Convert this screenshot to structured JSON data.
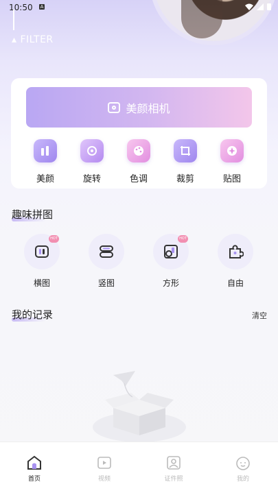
{
  "status_bar": {
    "time": "10:50",
    "notif": "A"
  },
  "header": {
    "filter_label": "FILTER"
  },
  "camera": {
    "label": "美颜相机"
  },
  "tools": [
    {
      "label": "美颜",
      "icon": "beauty-icon"
    },
    {
      "label": "旋转",
      "icon": "rotate-icon"
    },
    {
      "label": "色调",
      "icon": "palette-icon"
    },
    {
      "label": "裁剪",
      "icon": "crop-icon"
    },
    {
      "label": "贴图",
      "icon": "sticker-icon"
    }
  ],
  "collage": {
    "title": "趣味拼图",
    "items": [
      {
        "label": "横图",
        "icon": "horizontal-collage-icon",
        "badge": "HOT"
      },
      {
        "label": "竖图",
        "icon": "vertical-collage-icon",
        "badge": ""
      },
      {
        "label": "方形",
        "icon": "square-collage-icon",
        "badge": "HOT"
      },
      {
        "label": "自由",
        "icon": "puzzle-piece-icon",
        "badge": ""
      }
    ]
  },
  "records": {
    "title": "我的记录",
    "clear_label": "清空"
  },
  "bottom_nav": [
    {
      "label": "首页",
      "icon": "home-icon",
      "active": true
    },
    {
      "label": "视频",
      "icon": "video-icon",
      "active": false
    },
    {
      "label": "证件照",
      "icon": "id-photo-icon",
      "active": false
    },
    {
      "label": "我的",
      "icon": "profile-icon",
      "active": false
    }
  ],
  "colors": {
    "accent": "#a993f1",
    "pink": "#f3c6ea",
    "hot_badge": "#f28fb1"
  }
}
